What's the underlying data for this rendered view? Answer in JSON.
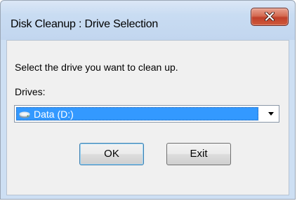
{
  "window": {
    "title": "Disk Cleanup : Drive Selection"
  },
  "dialog": {
    "prompt": "Select the drive you want to clean up.",
    "drives_label": "Drives:",
    "selected_drive": "Data (D:)",
    "drive_icon": "hard-drive-icon"
  },
  "buttons": {
    "ok_label": "OK",
    "exit_label": "Exit",
    "close_icon": "close-icon"
  },
  "colors": {
    "selection": "#3399ff",
    "close_button": "#c0402a",
    "titlebar": "#c9dcf2"
  }
}
